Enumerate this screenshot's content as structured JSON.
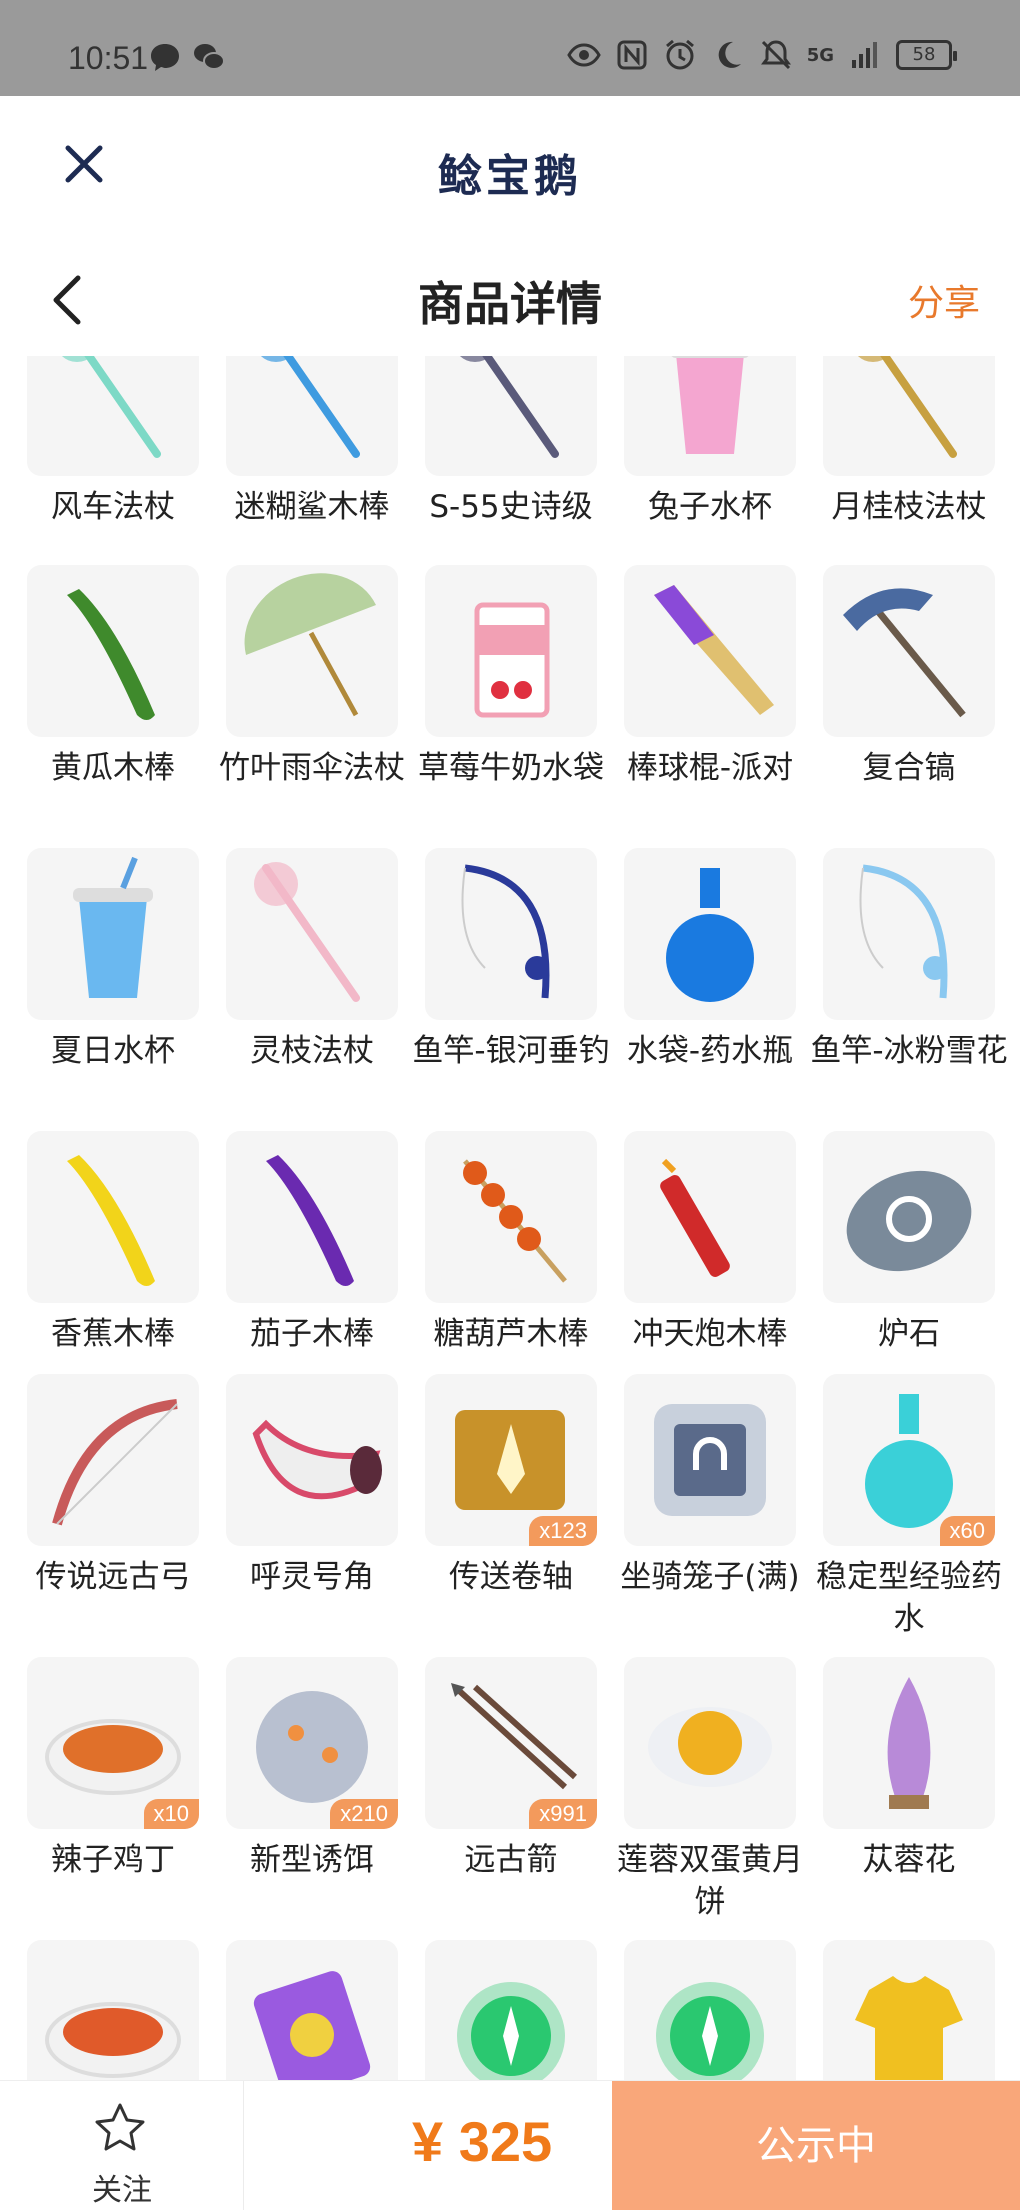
{
  "status_bar": {
    "time": "10:51",
    "network": "5G",
    "battery": "58"
  },
  "header": {
    "brand": "鲶宝鹅"
  },
  "nav": {
    "title": "商品详情",
    "share_label": "分享"
  },
  "items": [
    {
      "name": "风车法杖",
      "qty": "",
      "icon": "windmill-staff",
      "color": "#7dd9c6"
    },
    {
      "name": "迷糊鲨木棒",
      "qty": "",
      "icon": "shark-stick",
      "color": "#3f9be0"
    },
    {
      "name": "S-55史诗级",
      "qty": "",
      "icon": "rifle",
      "color": "#5a5a7a"
    },
    {
      "name": "兔子水杯",
      "qty": "",
      "icon": "bunny-cup",
      "color": "#f4a6d0"
    },
    {
      "name": "月桂枝法杖",
      "qty": "",
      "icon": "laurel-staff",
      "color": "#c7a040"
    },
    {
      "name": "黄瓜木棒",
      "qty": "",
      "icon": "cucumber",
      "color": "#3f8a2c"
    },
    {
      "name": "竹叶雨伞法杖",
      "qty": "",
      "icon": "umbrella",
      "color": "#a7c98a"
    },
    {
      "name": "草莓牛奶水袋",
      "qty": "",
      "icon": "milk-box",
      "color": "#f2a0b4"
    },
    {
      "name": "棒球棍-派对",
      "qty": "",
      "icon": "bat",
      "color": "#8a4ad8"
    },
    {
      "name": "复合镐",
      "qty": "",
      "icon": "pickaxe",
      "color": "#4a6aa0"
    },
    {
      "name": "夏日水杯",
      "qty": "",
      "icon": "summer-cup",
      "color": "#6ab8f0"
    },
    {
      "name": "灵枝法杖",
      "qty": "",
      "icon": "branch-staff",
      "color": "#f2b8c8"
    },
    {
      "name": "鱼竿-银河垂钓",
      "qty": "",
      "icon": "fishing-rod",
      "color": "#2a3a9a"
    },
    {
      "name": "水袋-药水瓶",
      "qty": "",
      "icon": "potion",
      "color": "#1a7ae0"
    },
    {
      "name": "鱼竿-冰粉雪花",
      "qty": "",
      "icon": "fishing-rod",
      "color": "#8ac8f0"
    },
    {
      "name": "香蕉木棒",
      "qty": "",
      "icon": "banana",
      "color": "#f2d41a"
    },
    {
      "name": "茄子木棒",
      "qty": "",
      "icon": "eggplant",
      "color": "#6a2ab0"
    },
    {
      "name": "糖葫芦木棒",
      "qty": "",
      "icon": "candied-haws",
      "color": "#e05a1a"
    },
    {
      "name": "冲天炮木棒",
      "qty": "",
      "icon": "firework",
      "color": "#d02a2a"
    },
    {
      "name": "炉石",
      "qty": "",
      "icon": "hearthstone",
      "color": "#7a8a9a"
    },
    {
      "name": "传说远古弓",
      "qty": "",
      "icon": "bow",
      "color": "#c85a5a"
    },
    {
      "name": "呼灵号角",
      "qty": "",
      "icon": "horn",
      "color": "#d84a6a"
    },
    {
      "name": "传送卷轴",
      "qty": "x123",
      "icon": "scroll",
      "color": "#c8922a"
    },
    {
      "name": "坐骑笼子(满)",
      "qty": "",
      "icon": "cage",
      "color": "#5a6a8a"
    },
    {
      "name": "稳定型经验药水",
      "qty": "x60",
      "icon": "exp-potion",
      "color": "#3ad0d8"
    },
    {
      "name": "辣子鸡丁",
      "qty": "x10",
      "icon": "dish",
      "color": "#e0702a"
    },
    {
      "name": "新型诱饵",
      "qty": "x210",
      "icon": "bait",
      "color": "#b8c0d0"
    },
    {
      "name": "远古箭",
      "qty": "x991",
      "icon": "arrows",
      "color": "#6a4a3a"
    },
    {
      "name": "莲蓉双蛋黄月饼",
      "qty": "",
      "icon": "mooncake",
      "color": "#f0b020"
    },
    {
      "name": "苁蓉花",
      "qty": "",
      "icon": "flower",
      "color": "#b88ad8"
    },
    {
      "name": "",
      "qty": "",
      "icon": "soup",
      "color": "#e05a2a"
    },
    {
      "name": "",
      "qty": "",
      "icon": "ticket",
      "color": "#9a5ae0"
    },
    {
      "name": "",
      "qty": "",
      "icon": "green-orb",
      "color": "#2ac870"
    },
    {
      "name": "",
      "qty": "",
      "icon": "green-orb",
      "color": "#2ac870"
    },
    {
      "name": "",
      "qty": "",
      "icon": "shirt",
      "color": "#f0c020"
    }
  ],
  "bottom_bar": {
    "follow_label": "关注",
    "price": "¥ 325",
    "status_label": "公示中"
  }
}
